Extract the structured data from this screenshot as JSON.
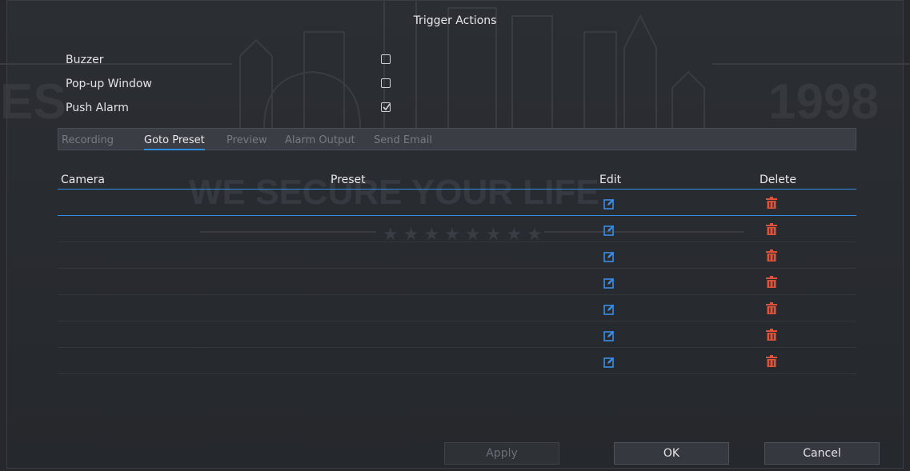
{
  "dialog": {
    "title": "Trigger Actions"
  },
  "options": [
    {
      "label": "Buzzer",
      "checked": false
    },
    {
      "label": "Pop-up Window",
      "checked": false
    },
    {
      "label": "Push Alarm",
      "checked": true
    }
  ],
  "tabs": [
    {
      "label": "Recording",
      "active": false
    },
    {
      "label": "Goto Preset",
      "active": true
    },
    {
      "label": "Preview",
      "active": false
    },
    {
      "label": "Alarm Output",
      "active": false
    },
    {
      "label": "Send Email",
      "active": false
    }
  ],
  "table": {
    "columns": [
      "Camera",
      "Preset",
      "Edit",
      "Delete"
    ],
    "rows": [
      {
        "camera": "",
        "preset": "",
        "selected": true
      },
      {
        "camera": "",
        "preset": "",
        "selected": false
      },
      {
        "camera": "",
        "preset": "",
        "selected": false
      },
      {
        "camera": "",
        "preset": "",
        "selected": false
      },
      {
        "camera": "",
        "preset": "",
        "selected": false
      },
      {
        "camera": "",
        "preset": "",
        "selected": false
      },
      {
        "camera": "",
        "preset": "",
        "selected": false
      }
    ]
  },
  "watermark": {
    "left_text": "ES",
    "year": "1998",
    "slogan": "WE SECURE YOUR LIFE"
  },
  "buttons": {
    "apply": "Apply",
    "ok": "OK",
    "cancel": "Cancel"
  },
  "icons": {
    "edit": "edit-icon",
    "delete": "trash-icon"
  },
  "colors": {
    "accent": "#2f8de4",
    "delete": "#e0533a",
    "edit": "#3b8ee6"
  }
}
